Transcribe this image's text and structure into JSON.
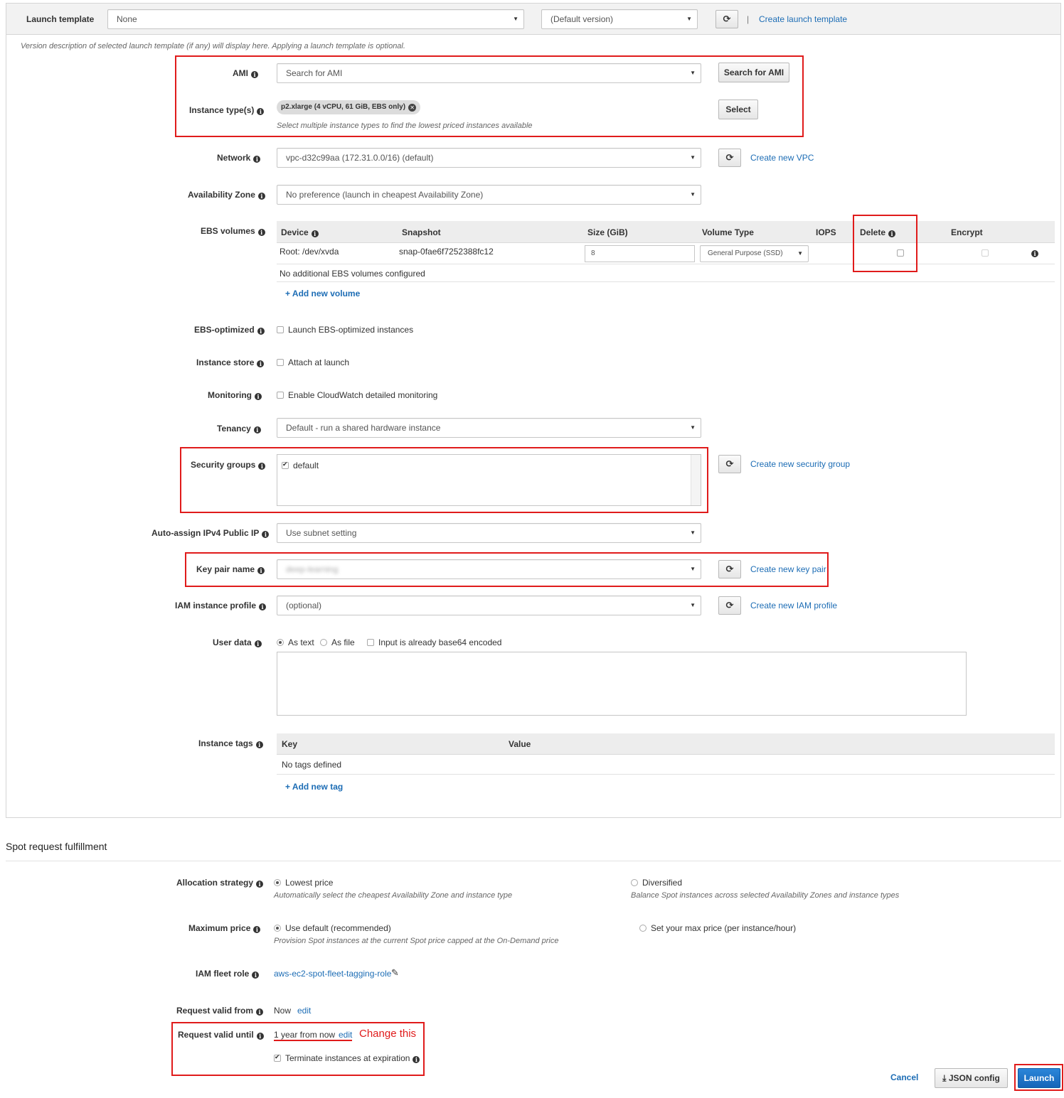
{
  "launch_template": {
    "label": "Launch template",
    "template_value": "None",
    "version_value": "(Default version)",
    "separator": "|",
    "create_link": "Create launch template",
    "description": "Version description of selected launch template (if any) will display here. Applying a launch template is optional."
  },
  "ami": {
    "label": "AMI",
    "placeholder": "Search for AMI",
    "search_button": "Search for AMI"
  },
  "instance_types": {
    "label": "Instance type(s)",
    "chip": "p2.xlarge (4 vCPU, 61 GiB, EBS only)",
    "select_button": "Select",
    "hint": "Select multiple instance types to find the lowest priced instances available"
  },
  "network": {
    "label": "Network",
    "value": "vpc-d32c99aa (172.31.0.0/16) (default)",
    "create_link": "Create new VPC"
  },
  "availability_zone": {
    "label": "Availability Zone",
    "value": "No preference (launch in cheapest Availability Zone)"
  },
  "ebs_volumes": {
    "label": "EBS volumes",
    "columns": {
      "device": "Device",
      "snapshot": "Snapshot",
      "size": "Size (GiB)",
      "volume_type": "Volume Type",
      "iops": "IOPS",
      "delete": "Delete",
      "encrypt": "Encrypt"
    },
    "row": {
      "device": "Root: /dev/xvda",
      "snapshot": "snap-0fae6f7252388fc12",
      "size": "8",
      "volume_type": "General Purpose (SSD)"
    },
    "empty_note": "No additional EBS volumes configured",
    "add_link": "+ Add new volume"
  },
  "ebs_optimized": {
    "label": "EBS-optimized",
    "checkbox_label": "Launch EBS-optimized instances"
  },
  "instance_store": {
    "label": "Instance store",
    "checkbox_label": "Attach at launch"
  },
  "monitoring": {
    "label": "Monitoring",
    "checkbox_label": "Enable CloudWatch detailed monitoring"
  },
  "tenancy": {
    "label": "Tenancy",
    "value": "Default - run a shared hardware instance"
  },
  "security_groups": {
    "label": "Security groups",
    "item": "default",
    "create_link": "Create new security group"
  },
  "auto_assign_ip": {
    "label": "Auto-assign IPv4 Public IP",
    "value": "Use subnet setting"
  },
  "key_pair": {
    "label": "Key pair name",
    "value": "deep-learning",
    "create_link": "Create new key pair"
  },
  "iam_profile": {
    "label": "IAM instance profile",
    "value": "(optional)",
    "create_link": "Create new IAM profile"
  },
  "user_data": {
    "label": "User data",
    "as_text": "As text",
    "as_file": "As file",
    "base64": "Input is already base64 encoded"
  },
  "instance_tags": {
    "label": "Instance tags",
    "columns": {
      "key": "Key",
      "value": "Value"
    },
    "empty_note": "No tags defined",
    "add_link": "+ Add new tag"
  },
  "spot_section": {
    "title": "Spot request fulfillment"
  },
  "allocation_strategy": {
    "label": "Allocation strategy",
    "lowest_price": "Lowest price",
    "lowest_price_hint": "Automatically select the cheapest Availability Zone and instance type",
    "diversified": "Diversified",
    "diversified_hint": "Balance Spot instances across selected Availability Zones and instance types"
  },
  "max_price": {
    "label": "Maximum price",
    "use_default": "Use default (recommended)",
    "use_default_hint": "Provision Spot instances at the current Spot price capped at the On-Demand price",
    "set_max": "Set your max price (per instance/hour)"
  },
  "iam_fleet_role": {
    "label": "IAM fleet role",
    "value": "aws-ec2-spot-fleet-tagging-role"
  },
  "valid_from": {
    "label": "Request valid from",
    "value": "Now",
    "edit": "edit"
  },
  "valid_until": {
    "label": "Request valid until",
    "value": "1 year from now",
    "edit": "edit",
    "annotation": "Change this",
    "terminate": "Terminate instances at expiration"
  },
  "footer": {
    "cancel": "Cancel",
    "json_config": "JSON config",
    "launch": "Launch"
  },
  "colors": {
    "link": "#1d6db5",
    "annotation_red": "#e01b1b",
    "launch_blue": "#1a73c8"
  },
  "icons": [
    "info-icon",
    "refresh-icon",
    "chevron-down-icon",
    "remove-icon",
    "pencil-icon",
    "download-icon"
  ]
}
